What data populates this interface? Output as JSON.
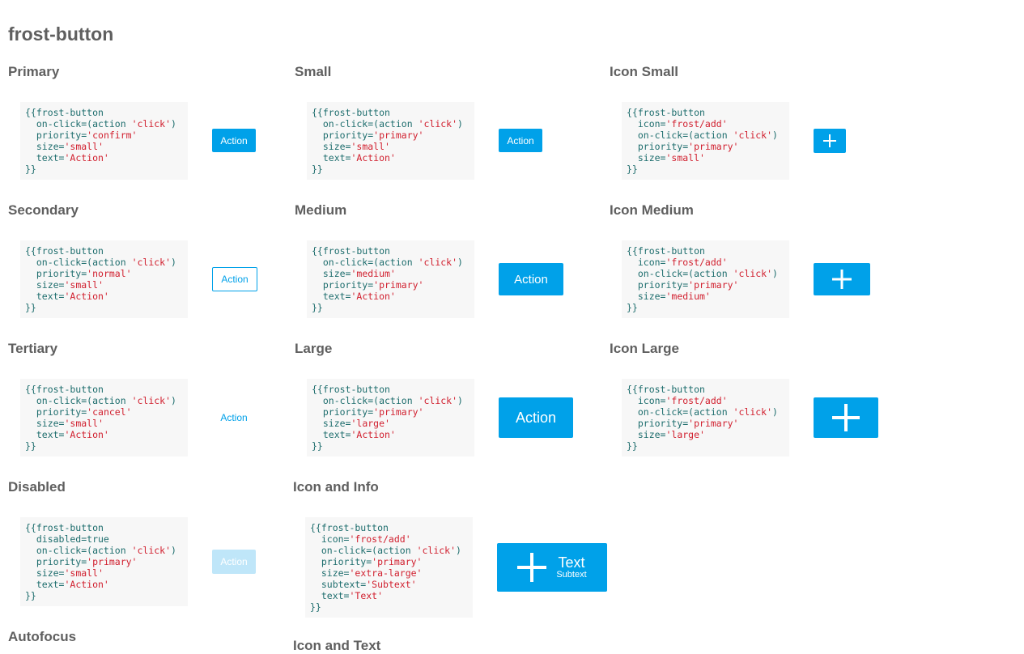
{
  "page": {
    "title": "frost-button"
  },
  "sections": {
    "primary": {
      "title": "Primary",
      "code": [
        "{{frost-button",
        "  on-click=(action 'click')",
        "  priority='confirm'",
        "  size='small'",
        "  text='Action'",
        "}}"
      ],
      "button": "Action"
    },
    "secondary": {
      "title": "Secondary",
      "code": [
        "{{frost-button",
        "  on-click=(action 'click')",
        "  priority='normal'",
        "  size='small'",
        "  text='Action'",
        "}}"
      ],
      "button": "Action"
    },
    "tertiary": {
      "title": "Tertiary",
      "code": [
        "{{frost-button",
        "  on-click=(action 'click')",
        "  priority='cancel'",
        "  size='small'",
        "  text='Action'",
        "}}"
      ],
      "button": "Action"
    },
    "disabled": {
      "title": "Disabled",
      "code": [
        "{{frost-button",
        "  disabled=true",
        "  on-click=(action 'click')",
        "  priority='primary'",
        "  size='small'",
        "  text='Action'",
        "}}"
      ],
      "button": "Action"
    },
    "autofocus": {
      "title": "Autofocus"
    },
    "small": {
      "title": "Small",
      "code": [
        "{{frost-button",
        "  on-click=(action 'click')",
        "  priority='primary'",
        "  size='small'",
        "  text='Action'",
        "}}"
      ],
      "button": "Action"
    },
    "medium": {
      "title": "Medium",
      "code": [
        "{{frost-button",
        "  on-click=(action 'click')",
        "  size='medium'",
        "  priority='primary'",
        "  text='Action'",
        "}}"
      ],
      "button": "Action"
    },
    "large": {
      "title": "Large",
      "code": [
        "{{frost-button",
        "  on-click=(action 'click')",
        "  priority='primary'",
        "  size='large'",
        "  text='Action'",
        "}}"
      ],
      "button": "Action"
    },
    "icon_and_info": {
      "title": "Icon and Info",
      "code": [
        "{{frost-button",
        "  icon='frost/add'",
        "  on-click=(action 'click')",
        "  priority='primary'",
        "  size='extra-large'",
        "  subtext='Subtext'",
        "  text='Text'",
        "}}"
      ],
      "button_text": "Text",
      "button_subtext": "Subtext",
      "icon": "plus-icon"
    },
    "icon_and_text": {
      "title": "Icon and Text"
    },
    "icon_small": {
      "title": "Icon Small",
      "code": [
        "{{frost-button",
        "  icon='frost/add'",
        "  on-click=(action 'click')",
        "  priority='primary'",
        "  size='small'",
        "}}"
      ],
      "icon": "plus-icon"
    },
    "icon_medium": {
      "title": "Icon Medium",
      "code": [
        "{{frost-button",
        "  icon='frost/add'",
        "  on-click=(action 'click')",
        "  priority='primary'",
        "  size='medium'",
        "}}"
      ],
      "icon": "plus-icon"
    },
    "icon_large": {
      "title": "Icon Large",
      "code": [
        "{{frost-button",
        "  icon='frost/add'",
        "  on-click=(action 'click')",
        "  priority='primary'",
        "  size='large'",
        "}}"
      ],
      "icon": "plus-icon"
    }
  },
  "colors": {
    "primary": "#00a1e9",
    "disabled": "#bfe6f9",
    "code_background": "#f7f7f7",
    "code_text": "#1d6d6d",
    "code_string": "#d1202f"
  }
}
